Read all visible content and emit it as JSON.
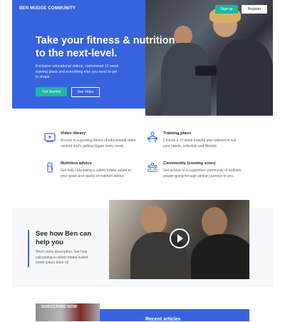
{
  "brand": "BEN MUDGE COMMUNITY",
  "nav": {
    "signup": "Sign up",
    "register": "Register"
  },
  "hero": {
    "title": "Take your fitness & nutrition to the next-level.",
    "text": "Exclusive educational videos, customised 12 week training plans and everything else you need to get in shape.",
    "cta_primary": "Get Started",
    "cta_secondary": "See Video"
  },
  "features": [
    {
      "icon": "video-library-icon",
      "title": "Video library",
      "text": "Access to a growing library of educational video content that's getting bigger every week."
    },
    {
      "icon": "training-plan-icon",
      "title": "Training plans",
      "text": "Choose a 12 week training plan tailored to suit your needs, schedule and lifestyle"
    },
    {
      "icon": "nutrition-icon",
      "title": "Nutrition advice",
      "text": "Get help calculating a caloric intake suited to your goals and stacks of nutrition advice"
    },
    {
      "icon": "community-icon",
      "title": "Community (coming soon)",
      "text": "Get access to a supportive community of ordinary people going through similar journeys to you"
    }
  ],
  "video_section": {
    "title": "See how Ben can help you",
    "text": "Short video description. Get help calculating a caloric intake suited lorem ipsum dolor sit"
  },
  "bottom": {
    "subscribe": "SUBSCRIBE NOW",
    "recent": "Recent articles"
  },
  "colors": {
    "primary": "#3763df",
    "accent": "#1fb5a5"
  }
}
